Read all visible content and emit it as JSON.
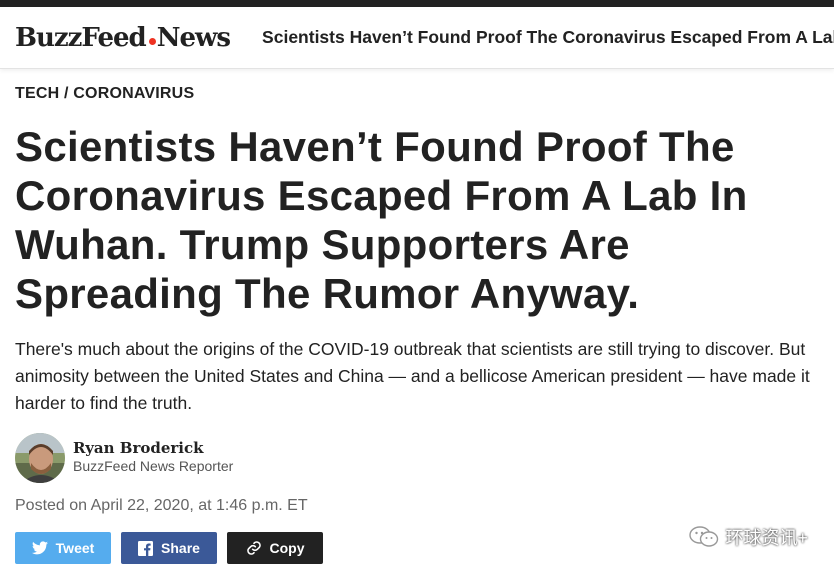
{
  "header": {
    "logo_main": "BuzzFeed",
    "logo_news": "News",
    "title": "Scientists Haven’t Found Proof The Coronavirus Escaped From A Lab In Wuhan. Trump Supporters Are Spreading The Rumor Anyway."
  },
  "article": {
    "breadcrumb": "TECH / CORONAVIRUS",
    "headline": "Scientists Haven’t Found Proof The Coronavirus Escaped From A Lab In Wuhan. Trump Supporters Are Spreading The Rumor Anyway.",
    "dek": "There's much about the origins of the COVID-19 outbreak that scientists are still trying to discover. But animosity between the United States and China — and a bellicose American president — have made it harder to find the truth.",
    "author_name": "Ryan Broderick",
    "author_role": "BuzzFeed News Reporter",
    "posted": "Posted on April 22, 2020, at 1:46 p.m. ET"
  },
  "share": {
    "tweet_label": "Tweet",
    "share_label": "Share",
    "copy_label": "Copy",
    "twitter_icon": "twitter-bird-icon",
    "facebook_icon": "facebook-f-icon",
    "link_icon": "link-icon"
  },
  "watermark": {
    "text": "环球资讯+",
    "icon": "wechat-icon"
  },
  "colors": {
    "brand_dot": "#ee3322",
    "twitter": "#55acee",
    "facebook": "#3b5998",
    "copy": "#222222"
  }
}
